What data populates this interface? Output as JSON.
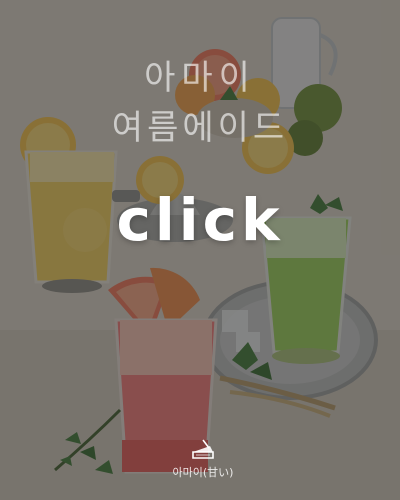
{
  "banner": {
    "title_line1": "아마이",
    "title_line2": "여름에이드",
    "cta_label": "click",
    "brand_name": "아마이(甘い)",
    "brand_icon": "cake-slice-icon"
  },
  "colors": {
    "overlay": "#2e2c2a",
    "lemon": "#f2c14a",
    "grapefruit": "#f0765a",
    "green_ade": "#9ad25a",
    "pink_ade": "#f27a7a",
    "mint": "#3f7a3a"
  }
}
